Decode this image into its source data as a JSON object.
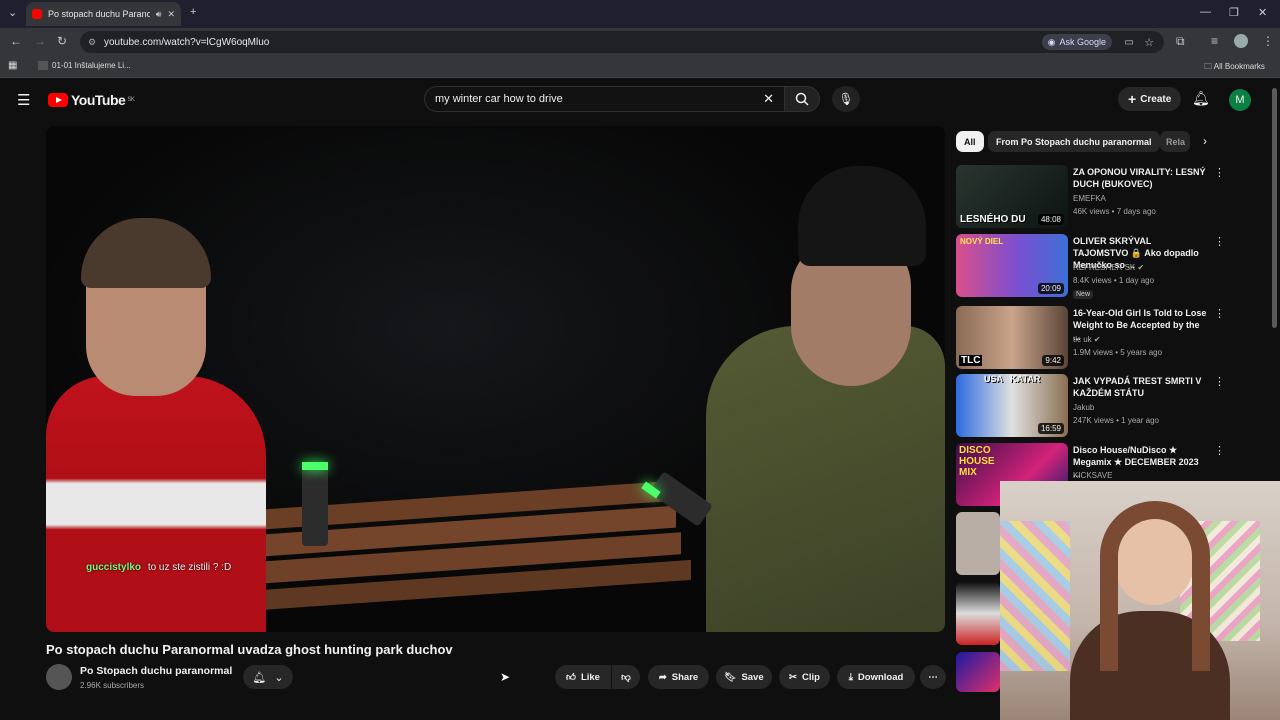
{
  "browser": {
    "tab_title": "Po stopach duchu Paranorm",
    "url": "youtube.com/watch?v=lCgW6oqMluo",
    "ask_google": "Ask Google",
    "bookmark_item": "01-01 Inštalujeme Li...",
    "all_bookmarks": "All Bookmarks"
  },
  "youtube": {
    "logo_text": "YouTube",
    "region": "SK",
    "search_query": "my winter car how to drive",
    "create_label": "Create",
    "avatar_letter": "M"
  },
  "video": {
    "chat_user": "guccistylko",
    "chat_message": "to uz ste zistili ? :D",
    "title": "Po stopach duchu Paranormal uvadza ghost hunting park duchov",
    "channel_name": "Po Stopach duchu paranormal",
    "subscribers": "2.96K subscribers",
    "actions": {
      "like": "Like",
      "share": "Share",
      "save": "Save",
      "clip": "Clip",
      "download": "Download"
    }
  },
  "chips": [
    "All",
    "From Po Stopach duchu paranormal",
    "Rela"
  ],
  "recommendations": [
    {
      "title": "ZA OPONOU VIRALITY: LESNÝ DUCH (BUKOVEC)",
      "channel": "EMEFKA",
      "meta": "46K views • 7 days ago",
      "duration": "48:08",
      "thumb_text": "LESNÉHO DU"
    },
    {
      "title": "OLIVER SKRÝVAL TAJOMSTVO 🔒 Ako dopadlo Menučko so ...",
      "channel": "REFRESHER SK",
      "meta": "8.4K views • 1 day ago",
      "duration": "20:09",
      "badge": "New",
      "thumb_text": "NOVÝ DIEL"
    },
    {
      "title": "16-Year-Old Girl Is Told to Lose Weight to Be Accepted by the ...",
      "channel": "tlc uk",
      "meta": "1.9M views • 5 years ago",
      "duration": "9:42",
      "thumb_text": "TLC"
    },
    {
      "title": "JAK VYPADÁ TREST SMRTI V KAŽDÉM STÁTU",
      "channel": "Jakub",
      "meta": "247K views • 1 year ago",
      "duration": "16:59",
      "thumb_text": "USA   KATAR"
    },
    {
      "title": "Disco House/NuDisco ★ Megamix ★ DECEMBER 2023 ...",
      "channel": "KICKSAVE",
      "meta": "",
      "duration": "",
      "thumb_text": "DISCO HOUSE MIX"
    }
  ],
  "colors": {
    "accent_red": "#ff0000",
    "background": "#0f0f0f",
    "button_bg": "#272727"
  }
}
